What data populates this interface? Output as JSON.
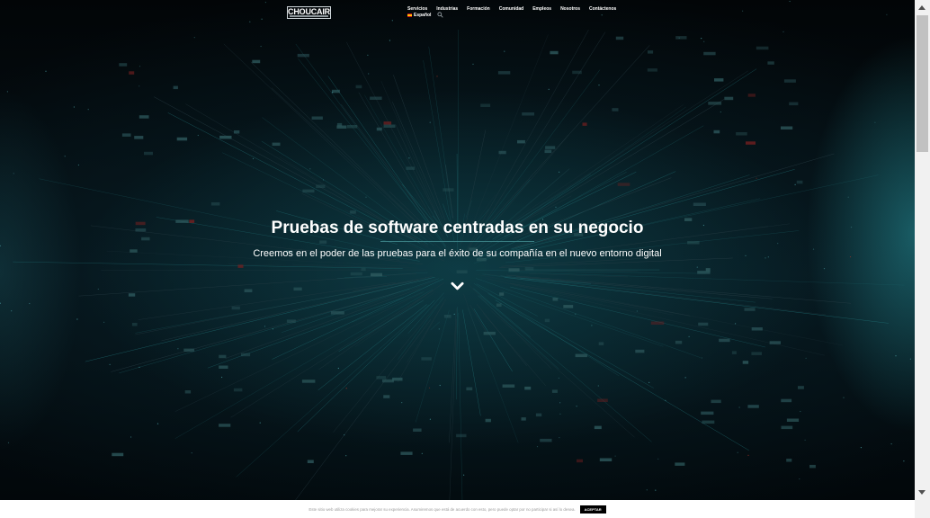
{
  "header": {
    "logo_text": "CHOUCAIR",
    "nav": [
      "Servicios",
      "Industrias",
      "Formación",
      "Comunidad",
      "Empleos",
      "Nosotros",
      "Contáctenos"
    ],
    "language": "Español",
    "search_icon": "search-icon"
  },
  "hero": {
    "title": "Pruebas de software centradas en su negocio",
    "subtitle": "Creemos en el poder de las pruebas para el éxito de su compañía en el nuevo entorno digital",
    "scroll_icon": "chevron-down-icon"
  },
  "cookie_bar": {
    "text": "Este sitio web utiliza cookies para mejorar su experiencia. Asumiremos que está de acuerdo con esto, pero puede optar por no participar si así lo desea.",
    "accept_label": "ACEPTAR"
  },
  "colors": {
    "background": "#03070b",
    "accent": "#3a7f84",
    "text": "#ffffff"
  }
}
